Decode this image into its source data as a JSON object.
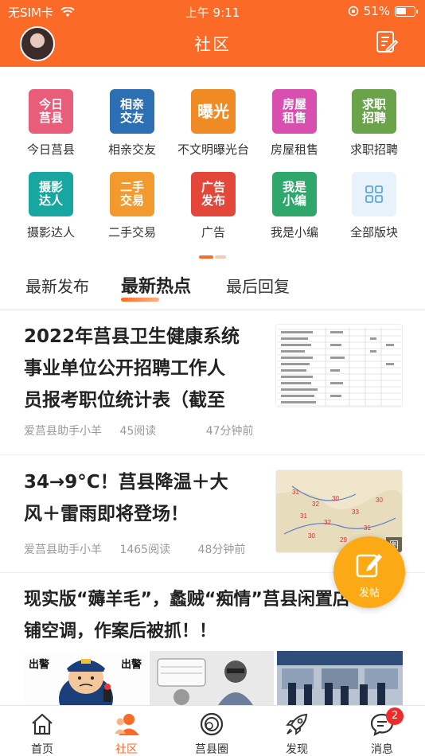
{
  "status_bar": {
    "carrier": "无SIM卡",
    "time": "上午 9:11",
    "battery": "51%"
  },
  "header": {
    "title": "社区",
    "avatar_icon": "user-avatar",
    "action_icon": "edit-post-icon"
  },
  "categories": [
    {
      "label": "今日莒县",
      "tile_text": "今日莒县",
      "color": "#e85d79"
    },
    {
      "label": "相亲交友",
      "tile_text": "相亲交友",
      "color": "#2d6fb3"
    },
    {
      "label": "不文明曝光台",
      "tile_text": "曝光",
      "color": "#f08a24"
    },
    {
      "label": "房屋租售",
      "tile_text": "房屋租售",
      "color": "#d84fb0"
    },
    {
      "label": "求职招聘",
      "tile_text": "求职招聘",
      "color": "#6aa34a"
    },
    {
      "label": "摄影达人",
      "tile_text": "摄影达人",
      "color": "#18a7a0"
    },
    {
      "label": "二手交易",
      "tile_text": "二手交易",
      "color": "#f39a2e"
    },
    {
      "label": "广告",
      "tile_text": "广告发布",
      "color": "#e2473a"
    },
    {
      "label": "我是小编",
      "tile_text": "我是小编",
      "color": "#2ea86a"
    },
    {
      "label": "全部版块",
      "tile_text": "",
      "color": "#e8f2fb"
    }
  ],
  "tabs": [
    {
      "label": "最新发布",
      "active": false
    },
    {
      "label": "最新热点",
      "active": true
    },
    {
      "label": "最后回复",
      "active": false
    }
  ],
  "articles": [
    {
      "title_lines": [
        "2022年莒县卫生健康系统",
        "事业单位公开招聘工作人",
        "员报考职位统计表（截至"
      ],
      "author": "爱莒县助手小羊",
      "reads": "45阅读",
      "time": "47分钟前",
      "thumb": "table-thumbnail"
    },
    {
      "title_lines": [
        "34→9°C！莒县降温＋大",
        "风＋雷雨即将登场！"
      ],
      "author": "爱莒县助手小羊",
      "reads": "1465阅读",
      "time": "48分钟前",
      "thumb": "weather-map-thumbnail",
      "thumb_tag": "图"
    },
    {
      "title_lines": [
        "现实版“薅羊毛”，蠡贼“痴情”莒县闲置店",
        "铺空调，作案后被抓！！"
      ],
      "images": [
        {
          "name": "cartoon-police-image",
          "caption_left": "出警",
          "caption_right": "出警"
        },
        {
          "name": "cartoon-thief-image"
        },
        {
          "name": "police-station-photo"
        }
      ]
    }
  ],
  "fab": {
    "label": "发帖",
    "icon": "write-icon"
  },
  "tabbar": [
    {
      "label": "首页",
      "icon": "home-icon",
      "active": false
    },
    {
      "label": "社区",
      "icon": "community-icon",
      "active": true
    },
    {
      "label": "莒县圈",
      "icon": "circle-icon",
      "active": false
    },
    {
      "label": "发现",
      "icon": "rocket-icon",
      "active": false
    },
    {
      "label": "消息",
      "icon": "message-icon",
      "active": false,
      "badge": "2"
    }
  ]
}
